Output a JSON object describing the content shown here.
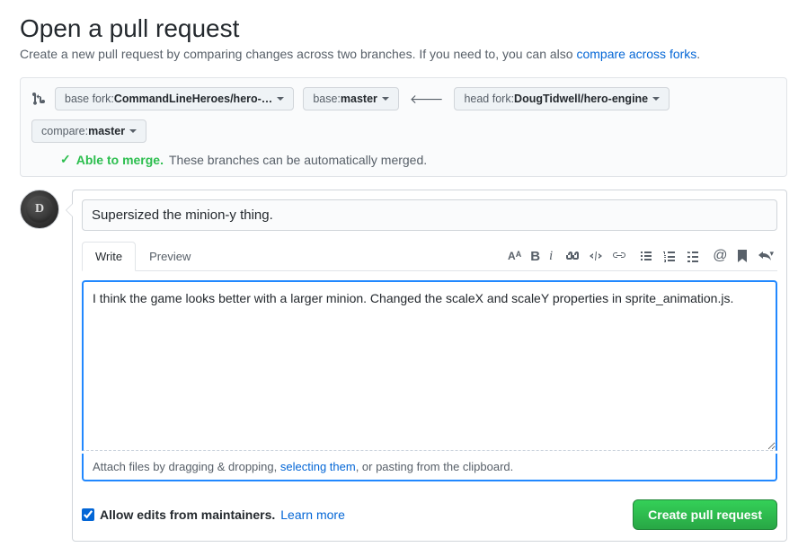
{
  "header": {
    "title": "Open a pull request",
    "subtitle_pre": "Create a new pull request by comparing changes across two branches. If you need to, you can also ",
    "subtitle_link": "compare across forks",
    "subtitle_post": "."
  },
  "branch": {
    "base_fork_label": "base fork: ",
    "base_fork_value": "CommandLineHeroes/hero-…",
    "base_label": "base: ",
    "base_value": "master",
    "head_fork_label": "head fork: ",
    "head_fork_value": "DougTidwell/hero-engine",
    "compare_label": "compare: ",
    "compare_value": "master"
  },
  "merge": {
    "check": "✓",
    "able": "Able to merge.",
    "rest": " These branches can be automatically merged."
  },
  "avatar": {
    "letter": "D"
  },
  "compose": {
    "title_value": "Supersized the minion-y thing.",
    "tabs": {
      "write": "Write",
      "preview": "Preview"
    },
    "body_value": "I think the game looks better with a larger minion. Changed the scaleX and scaleY properties in sprite_animation.js.",
    "attach_pre": "Attach files by dragging & dropping, ",
    "attach_link": "selecting them",
    "attach_post": ", or pasting from the clipboard."
  },
  "footer": {
    "allow_label": "Allow edits from maintainers.",
    "learn_more": "Learn more",
    "create_label": "Create pull request"
  }
}
